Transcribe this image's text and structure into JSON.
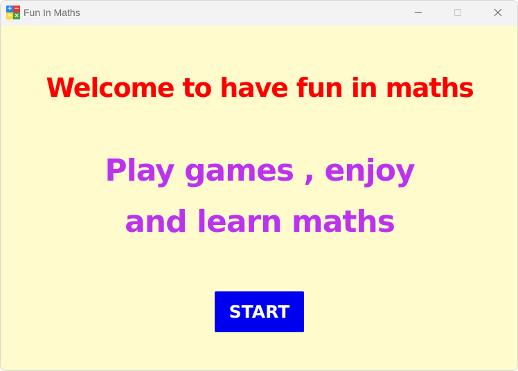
{
  "window": {
    "title": "Fun In Maths",
    "background": "#fffbcc",
    "app_icon": {
      "symbols": [
        "+",
        "−",
        "÷",
        "×"
      ],
      "colors": [
        "#1e88e5",
        "#e53935",
        "#fdd835",
        "#43a047"
      ]
    },
    "controls": {
      "minimize_icon": "minimize-icon",
      "maximize_icon": "maximize-icon",
      "close_icon": "close-icon"
    }
  },
  "main": {
    "headline": "Welcome to have fun in maths",
    "headline_color": "#ff0000",
    "tagline_line1": "Play games , enjoy",
    "tagline_line2": "and learn maths",
    "tagline_color": "#bb33ee",
    "start_label": "START",
    "start_color": "#0000f0"
  }
}
